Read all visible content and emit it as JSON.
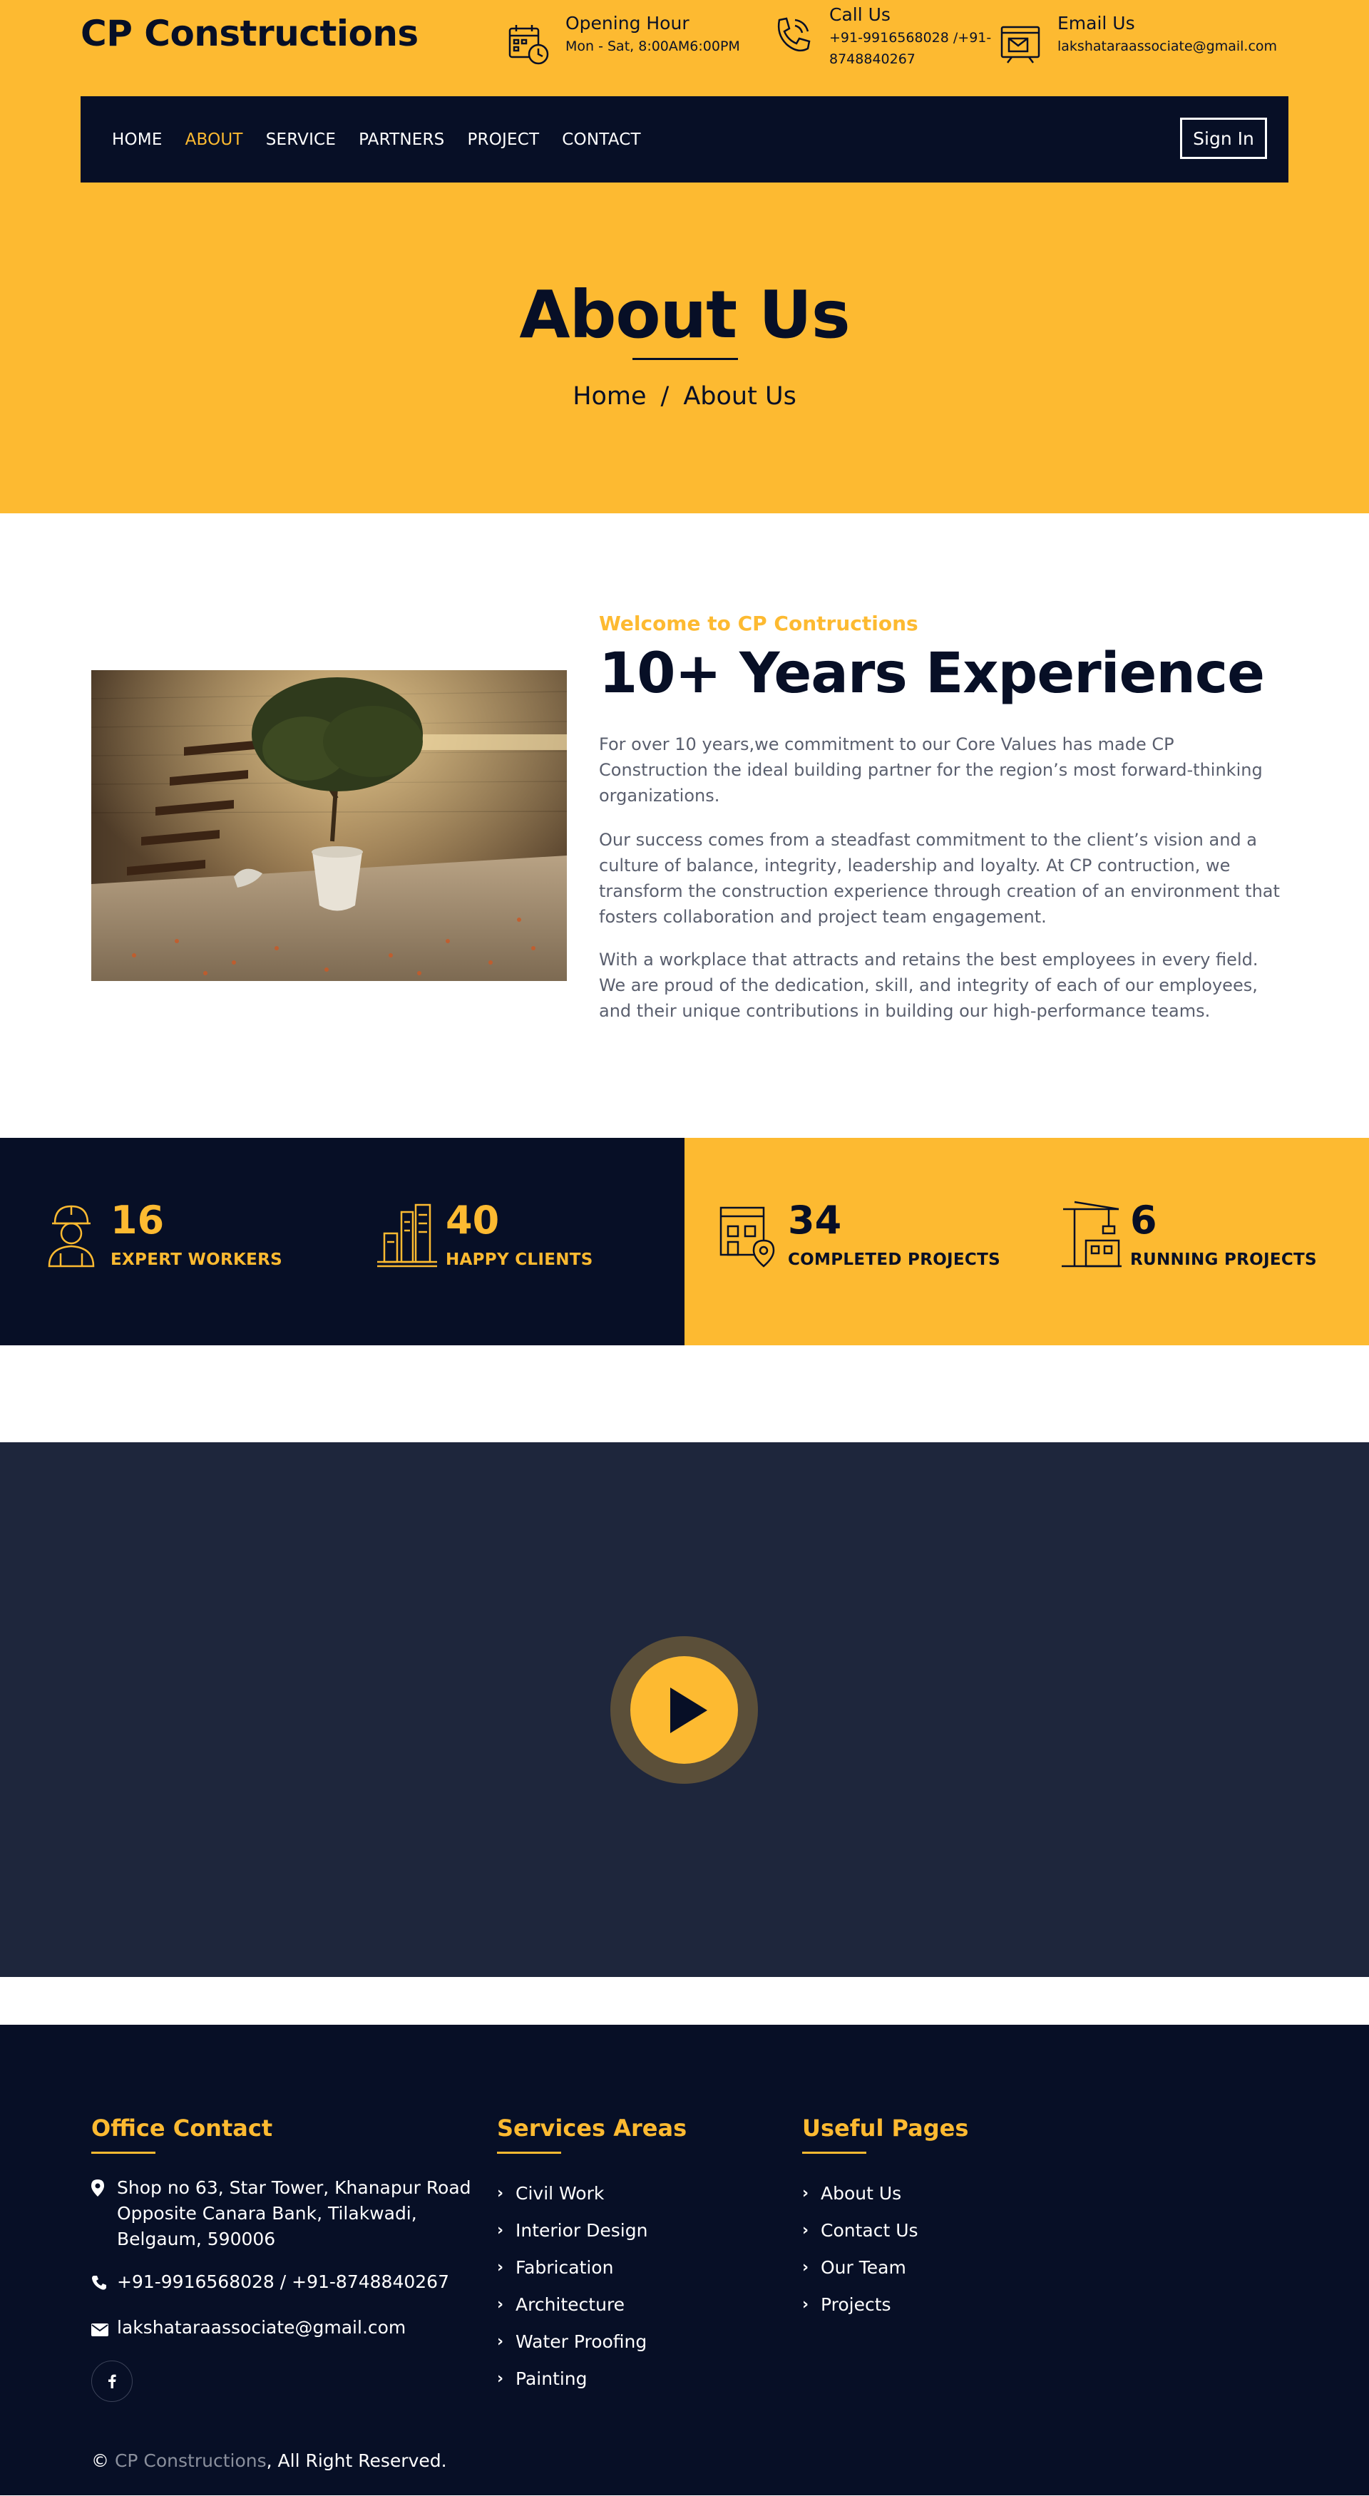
{
  "header": {
    "brand": "CP Constructions",
    "opening": {
      "title": "Opening Hour",
      "detail": "Mon - Sat, 8:00AM6:00PM"
    },
    "call": {
      "title": "Call Us",
      "detail": "+91-9916568028 /+91-8748840267"
    },
    "email": {
      "title": "Email Us",
      "detail": "lakshataraassociate@gmail.com"
    }
  },
  "nav": {
    "items": [
      "HOME",
      "ABOUT",
      "SERVICE",
      "PARTNERS",
      "PROJECT",
      "CONTACT"
    ],
    "active": "ABOUT",
    "signin": "Sign In"
  },
  "hero": {
    "title": "About Us",
    "breadcrumb": {
      "home": "Home",
      "separator": "/",
      "current": "About Us"
    }
  },
  "about": {
    "kicker": "Welcome to CP Contructions",
    "heading": "10+ Years Experience",
    "paragraphs": [
      "For over 10 years,we commitment to our Core Values has made CP Construction the ideal building partner for the region’s most forward-thinking organizations.",
      "Our success comes from a steadfast commitment to the client’s vision and a culture of balance, integrity, leadership and loyalty. At CP contruction, we transform the construction experience through creation of an environment that fosters collaboration and project team engagement.",
      "With a workplace that attracts and retains the best employees in every field. We are proud of the dedication, skill, and integrity of each of our employees, and their unique contributions in building our high-performance teams."
    ]
  },
  "stats": [
    {
      "value": "16",
      "label": "EXPERT WORKERS",
      "icon": "worker-icon"
    },
    {
      "value": "40",
      "label": "HAPPY CLIENTS",
      "icon": "buildings-icon"
    },
    {
      "value": "34",
      "label": "COMPLETED PROJECTS",
      "icon": "location-building-icon"
    },
    {
      "value": "6",
      "label": "RUNNING PROJECTS",
      "icon": "crane-icon"
    }
  ],
  "footer": {
    "office": {
      "title": "Office Contact",
      "address": "Shop no 63, Star Tower, Khanapur Road Opposite Canara Bank, Tilakwadi, Belgaum, 590006",
      "phone": "+91-9916568028 / +91-8748840267",
      "email": "lakshataraassociate@gmail.com"
    },
    "services": {
      "title": "Services Areas",
      "items": [
        "Civil Work",
        "Interior Design",
        "Fabrication",
        "Architecture",
        "Water Proofing",
        "Painting"
      ]
    },
    "pages": {
      "title": "Useful Pages",
      "items": [
        "About Us",
        "Contact Us",
        "Our Team",
        "Projects"
      ]
    },
    "copyright": {
      "symbol": "©",
      "brand": "CP Constructions",
      "rest": ", All Right Reserved."
    }
  },
  "colors": {
    "accent": "#fdba31",
    "navy": "#070f26",
    "video_bg": "#1e263c"
  }
}
